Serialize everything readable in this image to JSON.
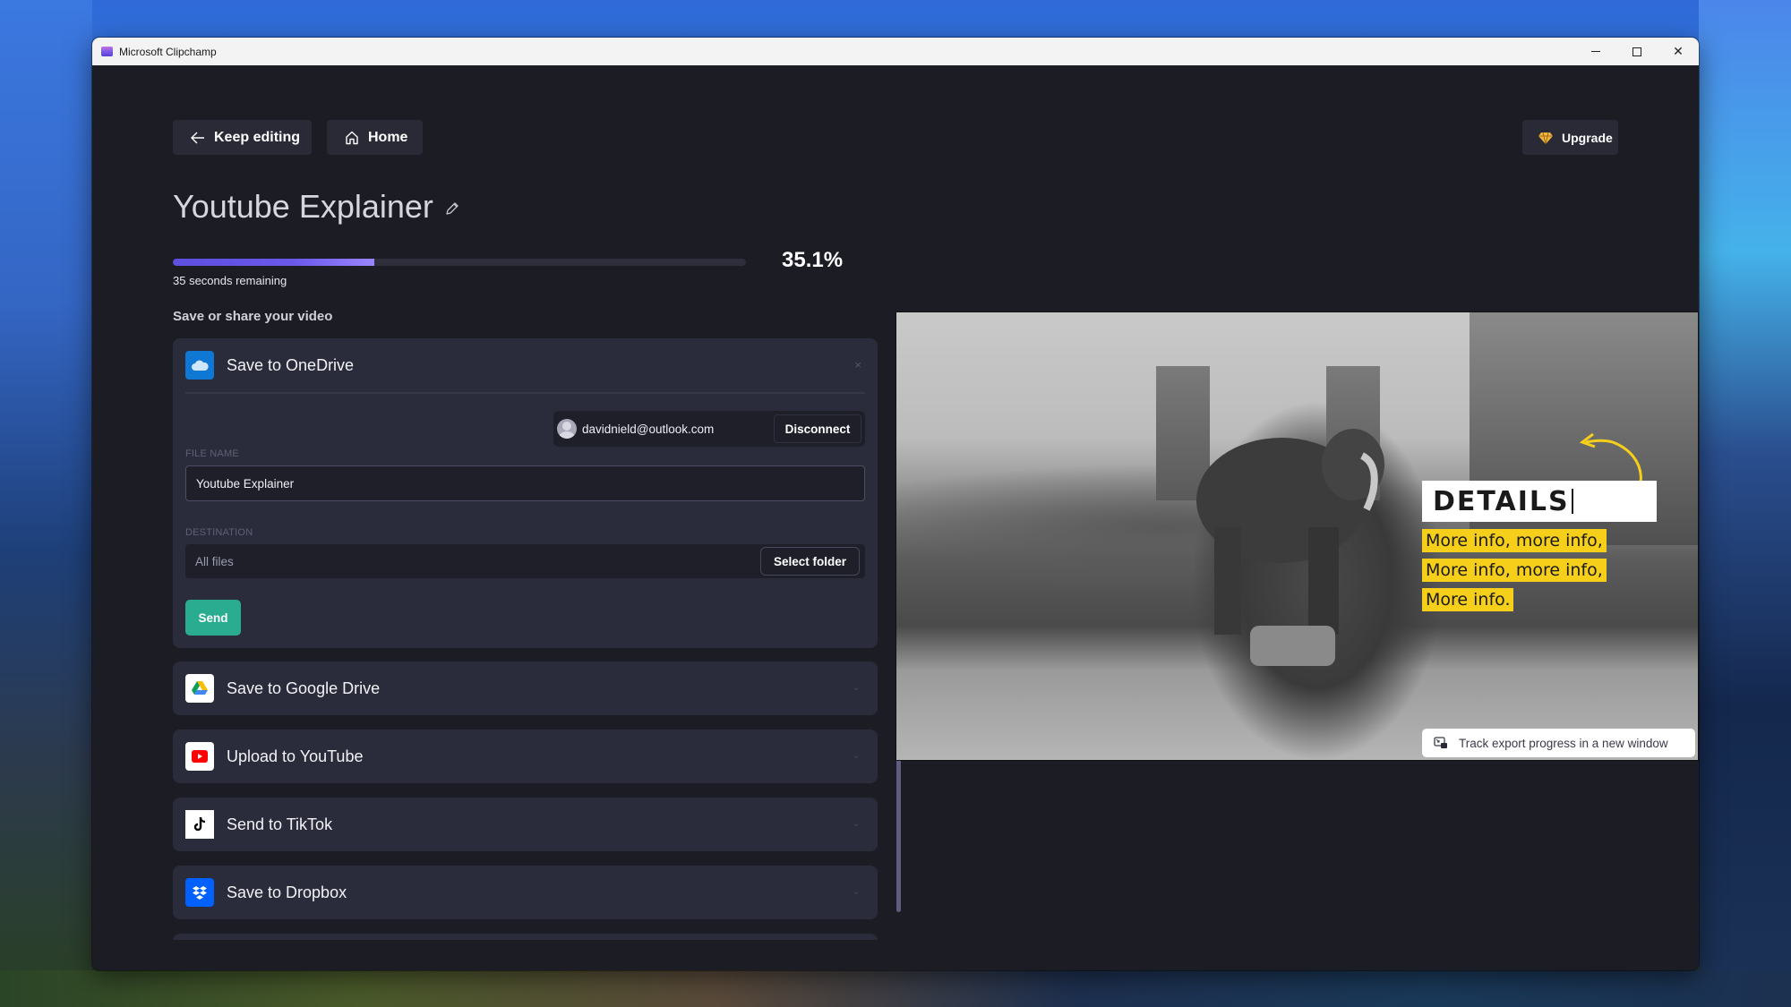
{
  "window": {
    "title": "Microsoft Clipchamp",
    "controls": {
      "minimize": "minimize",
      "maximize": "maximize",
      "close": "✕"
    }
  },
  "nav": {
    "keep_editing": "Keep editing",
    "home": "Home",
    "upgrade": "Upgrade"
  },
  "project": {
    "title": "Youtube Explainer"
  },
  "export": {
    "progress_percent": 35.1,
    "progress_label": "35.1%",
    "remaining": "35 seconds remaining",
    "section_label": "Save or share your video"
  },
  "onedrive": {
    "title": "Save to OneDrive",
    "close": "×",
    "account_email": "davidnield@outlook.com",
    "disconnect": "Disconnect",
    "file_name_label": "FILE NAME",
    "file_name_value": "Youtube Explainer",
    "destination_label": "DESTINATION",
    "destination_value": "All files",
    "select_folder": "Select folder",
    "send": "Send"
  },
  "services": [
    {
      "title": "Save to Google Drive",
      "icon": "google-drive-icon",
      "chevron": "⌄"
    },
    {
      "title": "Upload to YouTube",
      "icon": "youtube-icon",
      "chevron": "⌄"
    },
    {
      "title": "Send to TikTok",
      "icon": "tiktok-icon",
      "chevron": "⌄"
    },
    {
      "title": "Save to Dropbox",
      "icon": "dropbox-icon",
      "chevron": "⌄"
    }
  ],
  "preview": {
    "heading": "DETAILS",
    "lines": [
      "More info, more info,",
      "More info, more info,",
      "More info."
    ],
    "accent_yellow": "#f5cf1a",
    "track_button": "Track export progress in a new window"
  },
  "colors": {
    "app_bg": "#1c1c25",
    "card_bg": "#2b2c3b",
    "send_green": "#2aac90",
    "progress_purple": "#6a58ea",
    "onedrive_blue": "#0f78d4",
    "dropbox_blue": "#0061fe",
    "youtube_red": "#ff0000"
  }
}
